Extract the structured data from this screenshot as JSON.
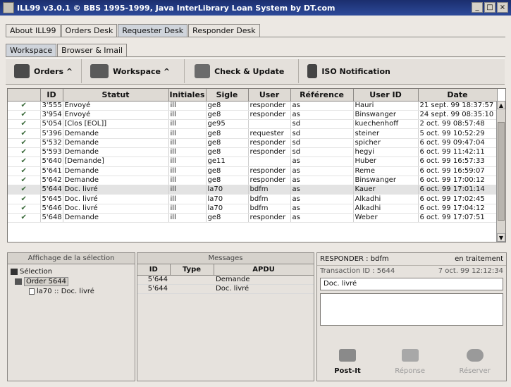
{
  "window": {
    "title": "ILL99 v3.0.1 © BBS 1995-1999, Java InterLibrary Loan System by DT.com",
    "buttons": [
      "_",
      "□",
      "×"
    ]
  },
  "main_tabs": [
    {
      "label": "About ILL99"
    },
    {
      "label": "Orders Desk"
    },
    {
      "label": "Requester Desk"
    },
    {
      "label": "Responder Desk"
    }
  ],
  "sub_tabs": [
    {
      "label": "Workspace"
    },
    {
      "label": "Browser & Imail"
    }
  ],
  "toolbar": {
    "orders": "Orders ^",
    "workspace": "Workspace ^",
    "check_update": "Check & Update",
    "iso_notification": "ISO Notification"
  },
  "table": {
    "headers": [
      "",
      "ID",
      "Statut",
      "Initiales",
      "Sigle",
      "User",
      "Référence",
      "User ID",
      "Date"
    ],
    "rows": [
      [
        "✔",
        "3'555",
        "Envoyé",
        "ill",
        "ge8",
        "responder",
        "as",
        "Hauri",
        "21 sept. 99 18:37:57"
      ],
      [
        "✔",
        "3'954",
        "Envoyé",
        "ill",
        "ge8",
        "responder",
        "as",
        "Binswanger",
        "24 sept. 99 08:35:10"
      ],
      [
        "✔",
        "5'054",
        "[Clos [EOL]]",
        "ill",
        "ge95",
        "",
        "sd",
        "kuechenhoff",
        "2 oct. 99 08:57:48"
      ],
      [
        "✔",
        "5'396",
        "Demande",
        "ill",
        "ge8",
        "requester",
        "sd",
        "steiner",
        "5 oct. 99 10:52:29"
      ],
      [
        "✔",
        "5'532",
        "Demande",
        "ill",
        "ge8",
        "responder",
        "sd",
        "spicher",
        "6 oct. 99 09:47:04"
      ],
      [
        "✔",
        "5'593",
        "Demande",
        "ill",
        "ge8",
        "responder",
        "sd",
        "hegyi",
        "6 oct. 99 11:42:11"
      ],
      [
        "✔",
        "5'640",
        "[Demande]",
        "ill",
        "ge11",
        "",
        "as",
        "Huber",
        "6 oct. 99 16:57:33"
      ],
      [
        "✔",
        "5'641",
        "Demande",
        "ill",
        "ge8",
        "responder",
        "as",
        "Reme",
        "6 oct. 99 16:59:07"
      ],
      [
        "✔",
        "5'642",
        "Demande",
        "ill",
        "ge8",
        "responder",
        "as",
        "Binswanger",
        "6 oct. 99 17:00:12"
      ],
      [
        "✔",
        "5'644",
        "Doc. livré",
        "ill",
        "la70",
        "bdfm",
        "as",
        "Kauer",
        "6 oct. 99 17:01:14"
      ],
      [
        "✔",
        "5'645",
        "Doc. livré",
        "ill",
        "la70",
        "bdfm",
        "as",
        "Alkadhi",
        "6 oct. 99 17:02:45"
      ],
      [
        "✔",
        "5'646",
        "Doc. livré",
        "ill",
        "la70",
        "bdfm",
        "as",
        "Alkadhi",
        "6 oct. 99 17:04:12"
      ],
      [
        "✔",
        "5'648",
        "Demande",
        "ill",
        "ge8",
        "responder",
        "as",
        "Weber",
        "6 oct. 99 17:07:51"
      ]
    ]
  },
  "selection_panel": {
    "title": "Affichage de la sélection",
    "root": "Sélection",
    "order": "Order 5644",
    "child": "la70 :: Doc. livré"
  },
  "messages_panel": {
    "title": "Messages",
    "headers": [
      "ID",
      "Type",
      "APDU"
    ],
    "rows": [
      [
        "5'644",
        "",
        "Demande"
      ],
      [
        "5'644",
        "",
        "Doc. livré"
      ]
    ]
  },
  "responder_panel": {
    "title": "RESPONDER : bdfm",
    "status": "en traitement",
    "transaction_label": "Transaction ID : 5644",
    "transaction_date": "7 oct. 99 12:12:34",
    "field_value": "Doc. livré",
    "actions": {
      "postit": "Post-It",
      "reponse": "Réponse",
      "reserver": "Réserver"
    }
  }
}
